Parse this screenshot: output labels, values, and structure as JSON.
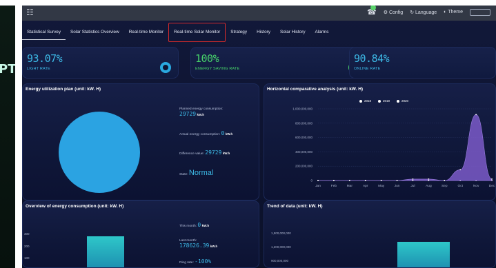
{
  "left_window": {
    "text": "PT"
  },
  "topbar": {
    "left_icon": "user-icon",
    "config_label": "Config",
    "language_label": "Language",
    "theme_label": "Theme"
  },
  "nav": {
    "tabs": [
      {
        "label": "Statistical Survey",
        "active": true
      },
      {
        "label": "Solar Statistics Overview"
      },
      {
        "label": "Real-time Monitor"
      },
      {
        "label": "Real-time Solar Monitor",
        "highlighted": true
      },
      {
        "label": "Strategy"
      },
      {
        "label": "History"
      },
      {
        "label": "Solar History"
      },
      {
        "label": "Alarms"
      }
    ]
  },
  "kpis": [
    {
      "value": "93.07%",
      "label": "LIGHT RATE"
    },
    {
      "value": "100%",
      "label": "ENERGY SAVING RATE"
    },
    {
      "value": "90.84%",
      "label": "ONLINE RATE"
    }
  ],
  "energy_plan": {
    "title": "Energy utilization plan (unit: kW. H)",
    "planned_label": "Planned energy consumption:",
    "planned_value": "29729",
    "planned_unit": "kW.h",
    "actual_label": "Actual energy consumption:",
    "actual_value": "0",
    "actual_unit": "kW.h",
    "difference_label": "Difference value:",
    "difference_value": "29729",
    "difference_unit": "kW.h",
    "state_label": "State:",
    "state_value": "Normal"
  },
  "horizontal": {
    "title": "Horizontal comparative analysis (unit: kW. H)",
    "legend": [
      "2018",
      "2019",
      "2020"
    ],
    "y_ticks": [
      "1,000,000,000",
      "800,000,000",
      "600,000,000",
      "400,000,000",
      "200,000,000",
      "0"
    ]
  },
  "consumption": {
    "title": "Overview of energy consumption (unit: kW. H)",
    "this_month_label": "This month:",
    "this_month_value": "0",
    "this_month_unit": "kW.h",
    "last_month_label": "Last month:",
    "last_month_value": "178626.39",
    "last_month_unit": "kW.h",
    "ring_rate_label": "Ring rate:",
    "ring_rate_value": "-100%"
  },
  "trend": {
    "title": "Trend of data (unit: kW. H)",
    "y_ticks": [
      "1,500,000,000",
      "1,200,000,000",
      "900,000,000"
    ]
  },
  "chart_data": {
    "type": "area",
    "title": "Horizontal comparative analysis (unit: kW. H)",
    "categories": [
      "Jan",
      "Feb",
      "Mar",
      "Apr",
      "May",
      "Jun",
      "Jul",
      "Aug",
      "Sep",
      "Oct",
      "Nov",
      "Dec"
    ],
    "series": [
      {
        "name": "2018",
        "values": [
          0,
          0,
          0,
          0,
          0,
          0,
          0,
          0,
          0,
          0,
          0,
          0
        ]
      },
      {
        "name": "2019",
        "values": [
          0,
          0,
          0,
          0,
          0,
          0,
          20000000,
          20000000,
          0,
          0,
          0,
          0
        ]
      },
      {
        "name": "2020",
        "values": [
          0,
          0,
          0,
          0,
          0,
          0,
          0,
          0,
          0,
          150000000,
          920000000,
          20000000
        ]
      }
    ],
    "ylim": [
      0,
      1000000000
    ],
    "colors": {
      "area": "#7b5bc9",
      "dot": "#ffffff"
    },
    "grid": true,
    "legend": "top"
  }
}
